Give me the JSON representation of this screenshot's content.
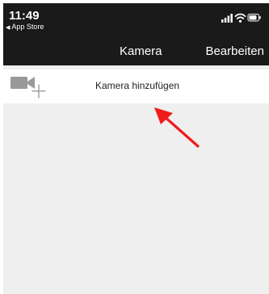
{
  "status_bar": {
    "time": "11:49",
    "back_app": "App Store",
    "back_arrow_icon": "◀",
    "signal_icon": "cellular-signal-icon",
    "wifi_icon": "wifi-icon",
    "battery_icon": "battery-icon"
  },
  "navbar": {
    "title": "Kamera",
    "edit_label": "Bearbeiten"
  },
  "list": {
    "add_camera_label": "Kamera hinzufügen",
    "add_camera_icon": "video-camera-add-icon"
  },
  "annotation": {
    "arrow_color": "#f21b1b"
  },
  "colors": {
    "bar_background": "#1a1a1a",
    "content_background": "#efefef",
    "row_background": "#ffffff",
    "icon_gray": "#999999"
  }
}
